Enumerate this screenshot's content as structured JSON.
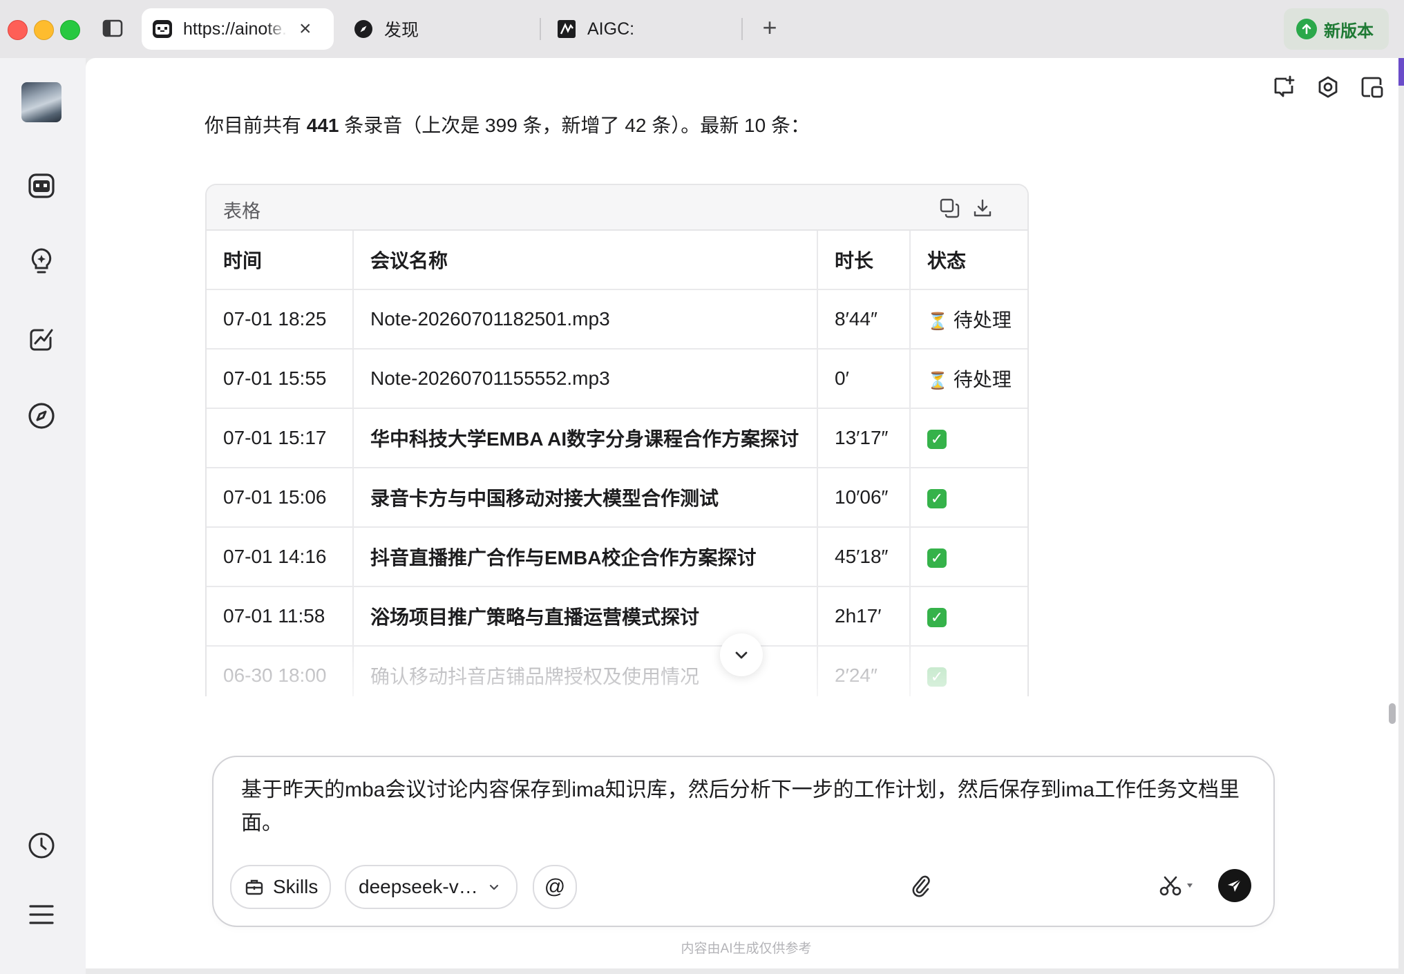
{
  "browser": {
    "tabs": [
      {
        "label": "https://ainote.tencent.com",
        "icon": "ainote-icon",
        "active": true
      },
      {
        "label": "发现",
        "icon": "compass-icon",
        "active": false
      },
      {
        "label": "AIGC:",
        "icon": "aigc-icon",
        "active": false
      }
    ],
    "update_label": "新版本"
  },
  "sidebar": {
    "items": [
      "avatar",
      "robot-icon",
      "lightbulb-icon",
      "chart-icon",
      "compass-icon",
      "history-icon",
      "menu-icon"
    ]
  },
  "message": {
    "intro_prefix": "你目前共有 ",
    "total": "441",
    "intro_suffix": " 条录音（上次是 399 条，新增了 42 条）。最新 10 条："
  },
  "table": {
    "title": "表格",
    "columns": [
      "时间",
      "会议名称",
      "时长",
      "状态"
    ],
    "rows": [
      {
        "time": "07-01 18:25",
        "name": "Note-20260701182501.mp3",
        "duration": "8′44″",
        "status": "待处理",
        "status_type": "pending",
        "bold": false
      },
      {
        "time": "07-01 15:55",
        "name": "Note-20260701155552.mp3",
        "duration": "0′",
        "status": "待处理",
        "status_type": "pending",
        "bold": false
      },
      {
        "time": "07-01 15:17",
        "name": "华中科技大学EMBA AI数字分身课程合作方案探讨",
        "duration": "13′17″",
        "status": "",
        "status_type": "done",
        "bold": true
      },
      {
        "time": "07-01 15:06",
        "name": "录音卡方与中国移动对接大模型合作测试",
        "duration": "10′06″",
        "status": "",
        "status_type": "done",
        "bold": true
      },
      {
        "time": "07-01 14:16",
        "name": "抖音直播推广合作与EMBA校企合作方案探讨",
        "duration": "45′18″",
        "status": "",
        "status_type": "done",
        "bold": true
      },
      {
        "time": "07-01 11:58",
        "name": "浴场项目推广策略与直播运营模式探讨",
        "duration": "2h17′",
        "status": "",
        "status_type": "done",
        "bold": true
      },
      {
        "time": "06-30 18:00",
        "name": "确认移动抖音店铺品牌授权及使用情况",
        "duration": "2′24″",
        "status": "",
        "status_type": "done",
        "bold": false
      }
    ]
  },
  "composer": {
    "text": "基于昨天的mba会议讨论内容保存到ima知识库，然后分析下一步的工作计划，然后保存到ima工作任务文档里面。",
    "skills_label": "Skills",
    "model_label": "deepseek-v…",
    "at_label": "@"
  },
  "disclaimer": "内容由AI生成仅供参考",
  "colors": {
    "accent_green": "#2aa84a",
    "send": "#151515",
    "check": "#35b24a"
  }
}
